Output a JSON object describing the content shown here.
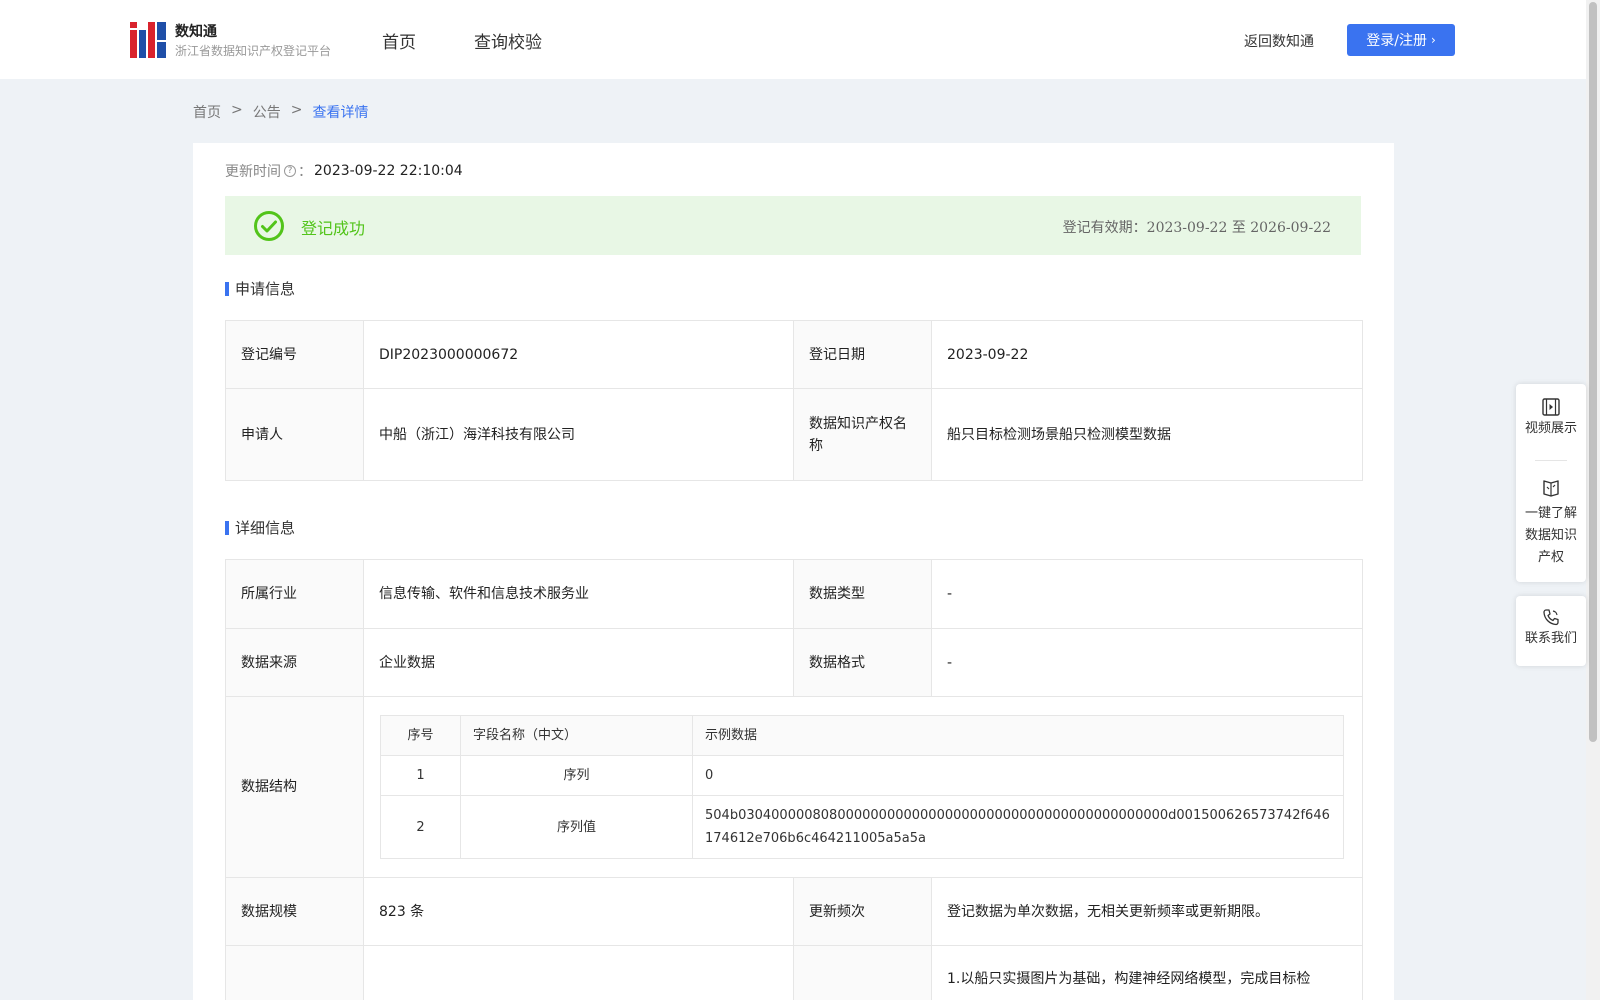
{
  "header": {
    "brand_name": "数知通",
    "brand_sub": "浙江省数据知识产权登记平台",
    "nav": [
      "首页",
      "查询校验"
    ],
    "return_link": "返回数知通",
    "login_label": "登录/注册"
  },
  "breadcrumb": [
    "首页",
    "公告",
    "查看详情"
  ],
  "update": {
    "label": "更新时间",
    "value": "2023-09-22 22:10:04"
  },
  "status": {
    "text": "登记成功",
    "validity_label": "登记有效期：",
    "validity_range": "2023-09-22 至 2026-09-22",
    "color": "#52c41a"
  },
  "apply_section": {
    "title": "申请信息",
    "reg_no_label": "登记编号",
    "reg_no": "DIP2023000000672",
    "reg_date_label": "登记日期",
    "reg_date": "2023-09-22",
    "applicant_label": "申请人",
    "applicant": "中船（浙江）海洋科技有限公司",
    "ip_name_label": "数据知识产权名称",
    "ip_name": "船只目标检测场景船只检测模型数据"
  },
  "detail_section": {
    "title": "详细信息",
    "industry_label": "所属行业",
    "industry": "信息传输、软件和信息技术服务业",
    "data_type_label": "数据类型",
    "data_type": "-",
    "source_label": "数据来源",
    "source": "企业数据",
    "format_label": "数据格式",
    "format": "-",
    "structure_label": "数据结构",
    "structure": {
      "headers": [
        "序号",
        "字段名称（中文）",
        "示例数据"
      ],
      "rows": [
        [
          "1",
          "序列",
          "0"
        ],
        [
          "2",
          "序列值",
          "504b0304000008080000000000000000000000000000000000000000d001500626573742f646174612e706b6c464211005a5a5a"
        ]
      ]
    },
    "scale_label": "数据规模",
    "scale": "823 条",
    "frequency_label": "更新频次",
    "frequency": "登记数据为单次数据，无相关更新频率或更新期限。",
    "description_partial": "1.以船只实摄图片为基础，构建神经网络模型，完成目标检"
  },
  "side_panel": {
    "video": "视频展示",
    "learn": "一键了解数据知识产权",
    "contact": "联系我们"
  },
  "colors": {
    "accent": "#3a73f0",
    "success": "#52c41a"
  }
}
